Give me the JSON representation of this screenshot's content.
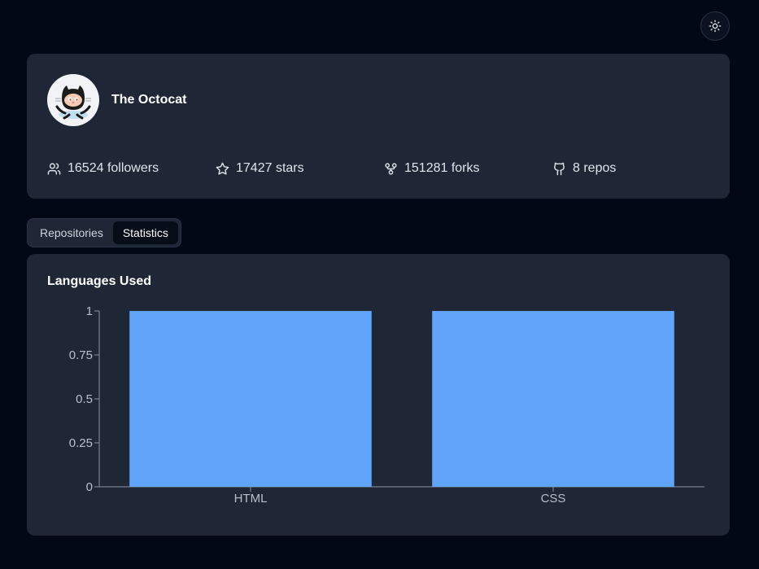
{
  "theme_toggle": {
    "icon": "sun-icon"
  },
  "profile": {
    "name": "The Octocat",
    "avatar_icon": "octocat-avatar",
    "stats": [
      {
        "icon": "users-icon",
        "text": "16524 followers"
      },
      {
        "icon": "star-icon",
        "text": "17427 stars"
      },
      {
        "icon": "fork-icon",
        "text": "151281 forks"
      },
      {
        "icon": "repo-icon",
        "text": "8 repos"
      }
    ]
  },
  "tabs": [
    {
      "label": "Repositories",
      "active": false
    },
    {
      "label": "Statistics",
      "active": true
    }
  ],
  "chart_card": {
    "title": "Languages Used"
  },
  "chart_data": {
    "type": "bar",
    "title": "Languages Used",
    "categories": [
      "HTML",
      "CSS"
    ],
    "values": [
      1,
      1
    ],
    "ylim": [
      0,
      1
    ],
    "yticks": [
      "0",
      "0.25",
      "0.5",
      "0.75",
      "1"
    ],
    "xlabel": "",
    "ylabel": "",
    "bar_color": "#60a5fa",
    "grid": false
  },
  "colors": {
    "page_bg": "#030816",
    "card_bg": "#1f2737",
    "axis": "#8a93a3"
  }
}
